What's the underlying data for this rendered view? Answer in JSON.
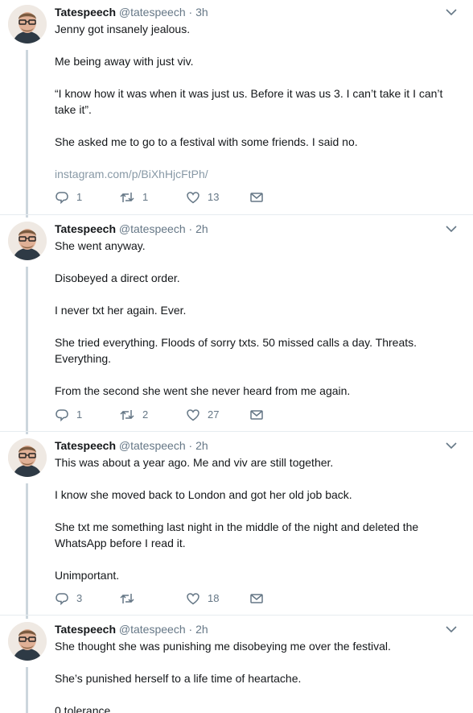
{
  "tweets": [
    {
      "name": "Tatespeech",
      "handle": "@tatespeech",
      "separator": "·",
      "time": "3h",
      "paragraphs": [
        "Jenny got insanely jealous.",
        "Me being away with just viv.",
        "“I know how it was when it was just us. Before it was us 3. I can’t take it I can’t take it”.",
        "She asked me to go to a festival with some friends. I said no."
      ],
      "link": "instagram.com/p/BiXhHjcFtPh/",
      "replies": "1",
      "retweets": "1",
      "likes": "13"
    },
    {
      "name": "Tatespeech",
      "handle": "@tatespeech",
      "separator": "·",
      "time": "2h",
      "paragraphs": [
        "She went anyway.",
        "Disobeyed a direct order.",
        "I never txt her again. Ever.",
        "She tried everything. Floods of sorry txts. 50 missed calls a day. Threats. Everything.",
        "From the second she went she never heard from me again."
      ],
      "replies": "1",
      "retweets": "2",
      "likes": "27"
    },
    {
      "name": "Tatespeech",
      "handle": "@tatespeech",
      "separator": "·",
      "time": "2h",
      "paragraphs": [
        "This was about a year ago. Me and viv are still together.",
        "I know she moved back to London and got her old job back.",
        "She txt me something last night in the middle of the night and deleted the WhatsApp before I read it.",
        "Unimportant."
      ],
      "replies": "3",
      "retweets": "",
      "likes": "18"
    },
    {
      "name": "Tatespeech",
      "handle": "@tatespeech",
      "separator": "·",
      "time": "2h",
      "paragraphs": [
        "She thought she was punishing me disobeying me over the festival.",
        "She’s punished herself to a life time of heartache.",
        "0 tolerance."
      ]
    }
  ],
  "icons": {
    "reply": "reply-icon",
    "retweet": "retweet-icon",
    "like": "heart-icon",
    "dm": "envelope-icon",
    "caret": "chevron-down-icon"
  },
  "colors": {
    "text": "#14171a",
    "secondary": "#657786",
    "link": "#8899a6",
    "thread_line": "#ccd6dd"
  }
}
